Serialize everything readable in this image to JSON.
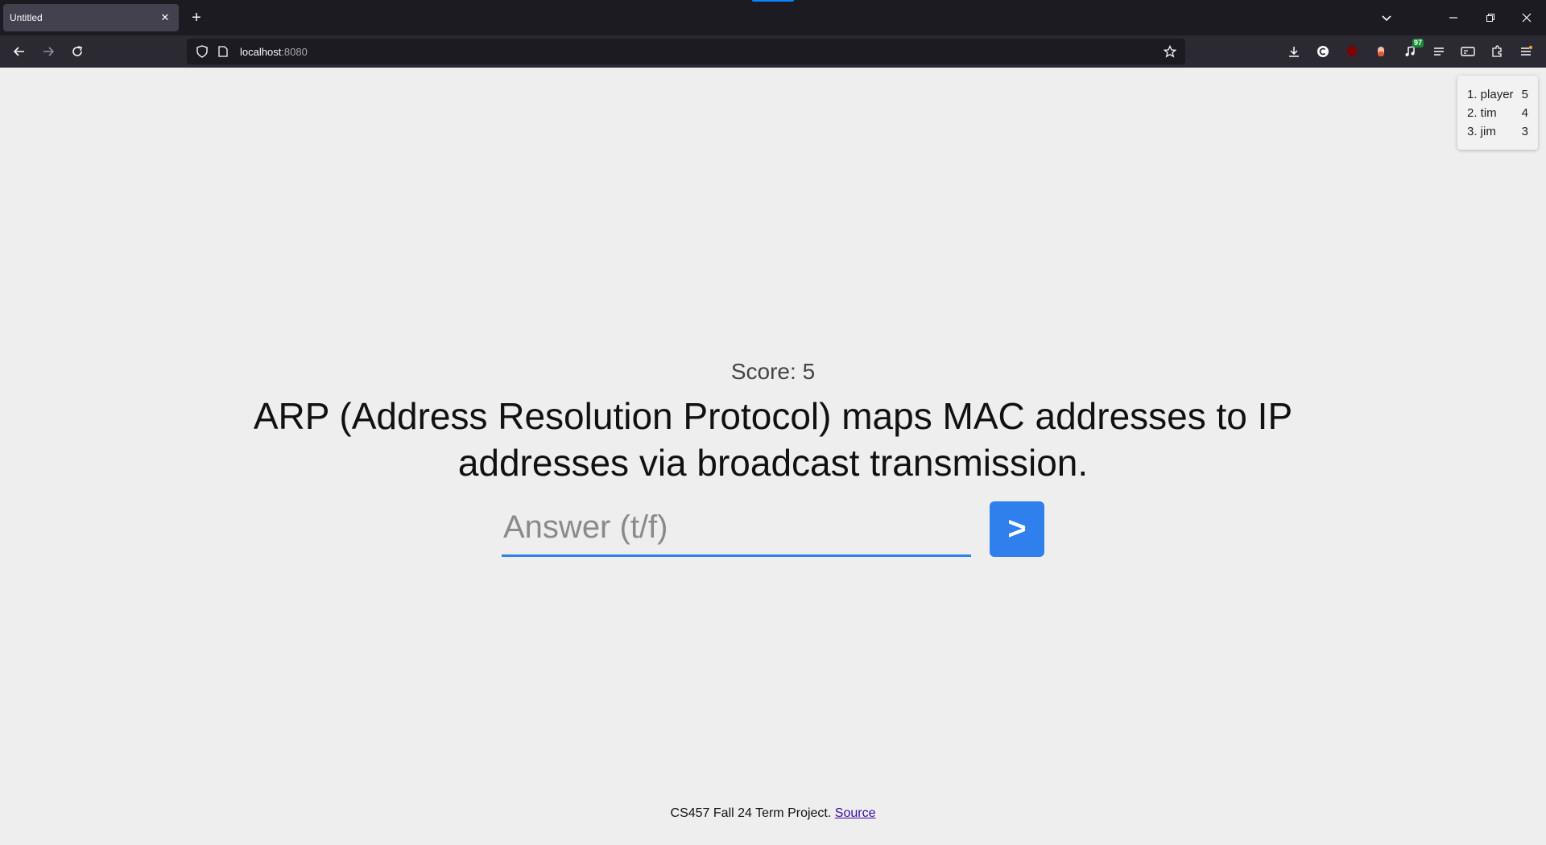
{
  "browser": {
    "tab": {
      "title": "Untitled",
      "close_glyph": "✕"
    },
    "new_tab_glyph": "+",
    "url": {
      "host": "localhost",
      "port": ":8080"
    },
    "extension_badge": "97",
    "icons": [
      "back-arrow-icon",
      "forward-arrow-icon",
      "reload-icon",
      "shield-icon",
      "page-icon",
      "star-icon",
      "download-icon",
      "extension-icon",
      "menu-icon"
    ]
  },
  "leaderboard": {
    "entries": [
      {
        "rank_name": "1. player",
        "score": "5"
      },
      {
        "rank_name": "2. tim",
        "score": "4"
      },
      {
        "rank_name": "3. jim",
        "score": "3"
      }
    ]
  },
  "game": {
    "score_label": "Score: 5",
    "question": "ARP (Address Resolution Protocol) maps MAC addresses to IP addresses via broadcast transmission.",
    "answer_placeholder": "Answer (t/f)",
    "answer_value": "",
    "submit_label": ">"
  },
  "footer": {
    "text": "CS457 Fall 24 Term Project. ",
    "link_label": "Source"
  },
  "colors": {
    "accent": "#2f80ed",
    "page_background": "#eeeeee",
    "chrome_dark": "#1c1b22"
  }
}
